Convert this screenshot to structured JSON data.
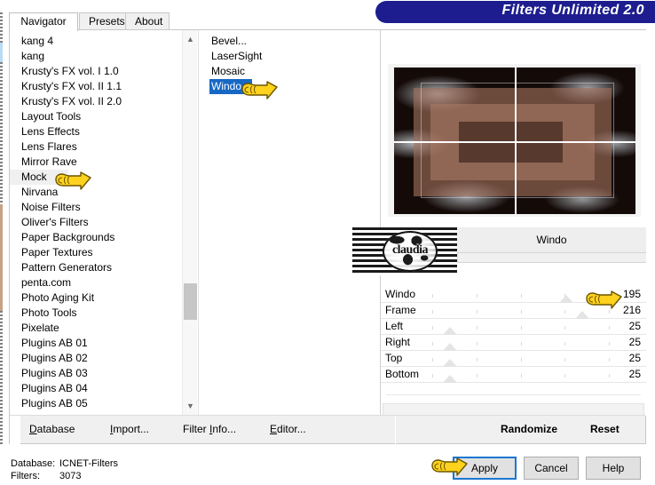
{
  "window": {
    "title": "Filters Unlimited 2.0"
  },
  "tabs": [
    {
      "label": "Navigator",
      "active": true
    },
    {
      "label": "Presets",
      "active": false
    },
    {
      "label": "About",
      "active": false
    }
  ],
  "categories": {
    "items": [
      "kang 4",
      "kang",
      "Krusty's FX vol. I 1.0",
      "Krusty's FX vol. II 1.1",
      "Krusty's FX vol. II 2.0",
      "Layout Tools",
      "Lens Effects",
      "Lens Flares",
      "Mirror Rave",
      "Mock",
      "Nirvana",
      "Noise Filters",
      "Oliver's Filters",
      "Paper Backgrounds",
      "Paper Textures",
      "Pattern Generators",
      "penta.com",
      "Photo Aging Kit",
      "Photo Tools",
      "Pixelate",
      "Plugins AB 01",
      "Plugins AB 02",
      "Plugins AB 03",
      "Plugins AB 04",
      "Plugins AB 05"
    ],
    "selected": "Mock",
    "scroll_up_icon": "chevron-up-icon",
    "scroll_down_icon": "chevron-down-icon"
  },
  "filters": {
    "items": [
      "Bevel...",
      "LaserSight",
      "Mosaic",
      "Windo"
    ],
    "selected": "Windo"
  },
  "preview": {
    "label": "preview-image",
    "crosshair": true
  },
  "filter_header": {
    "name": "Windo",
    "logo_text": "claudia"
  },
  "sliders": [
    {
      "label": "Windo",
      "value": "195",
      "pct": 76
    },
    {
      "label": "Frame",
      "value": "216",
      "pct": 85
    },
    {
      "label": "Left",
      "value": "25",
      "pct": 10
    },
    {
      "label": "Right",
      "value": "25",
      "pct": 10
    },
    {
      "label": "Top",
      "value": "25",
      "pct": 10
    },
    {
      "label": "Bottom",
      "value": "25",
      "pct": 10
    }
  ],
  "toolbar": {
    "database": "Database",
    "import": "Import...",
    "filter_info": "Filter Info...",
    "editor": "Editor...",
    "randomize": "Randomize",
    "reset": "Reset"
  },
  "status": {
    "database_key": "Database:",
    "database_value": "ICNET-Filters",
    "filters_key": "Filters:",
    "filters_value": "3073"
  },
  "buttons": {
    "apply": "Apply",
    "cancel": "Cancel",
    "help": "Help"
  },
  "colors": {
    "title_band": "#1d1d8f",
    "selection": "#1768c4",
    "focus_border": "#1b78d0",
    "toolbar_bg": "#f0f0f0",
    "hand_cursor": "#ffd700"
  }
}
